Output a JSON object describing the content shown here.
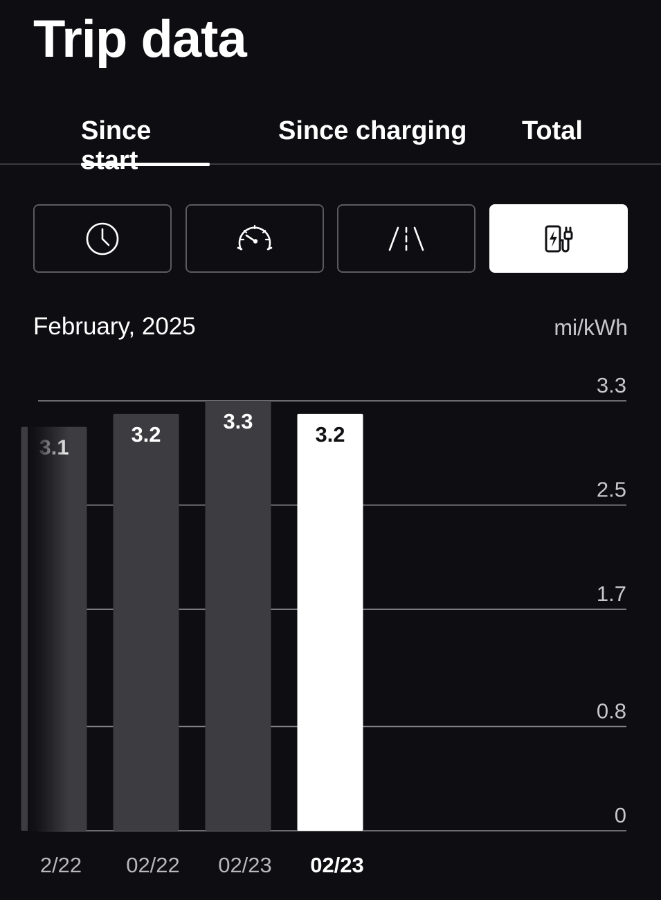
{
  "header": {
    "title": "Trip data"
  },
  "tabs": [
    {
      "label": "Since start",
      "active": true
    },
    {
      "label": "Since charging",
      "active": false
    },
    {
      "label": "Total",
      "active": false
    }
  ],
  "metric_buttons": [
    {
      "icon": "clock-icon",
      "selected": false
    },
    {
      "icon": "speedometer-icon",
      "selected": false
    },
    {
      "icon": "road-icon",
      "selected": false
    },
    {
      "icon": "charging-station-icon",
      "selected": true
    }
  ],
  "chart_header": {
    "period": "February, 2025",
    "unit": "mi/kWh"
  },
  "colors": {
    "background": "#0e0e12",
    "bar": "#3c3c41",
    "bar_selected": "#ffffff",
    "grid": "#8a8a90"
  },
  "chart_data": {
    "type": "bar",
    "categories": [
      "2/22",
      "02/22",
      "02/23",
      "02/23"
    ],
    "values": [
      3.1,
      3.2,
      3.3,
      3.2
    ],
    "value_labels": [
      "3.1",
      "3.2",
      "3.3",
      "3.2"
    ],
    "selected_index": 3,
    "ylim": [
      0,
      3.3
    ],
    "y_ticks": [
      0,
      0.8,
      1.7,
      2.5,
      3.3
    ],
    "y_tick_labels": [
      "0",
      "0.8",
      "1.7",
      "2.5",
      "3.3"
    ],
    "y_axis_side": "right",
    "grid": true
  }
}
